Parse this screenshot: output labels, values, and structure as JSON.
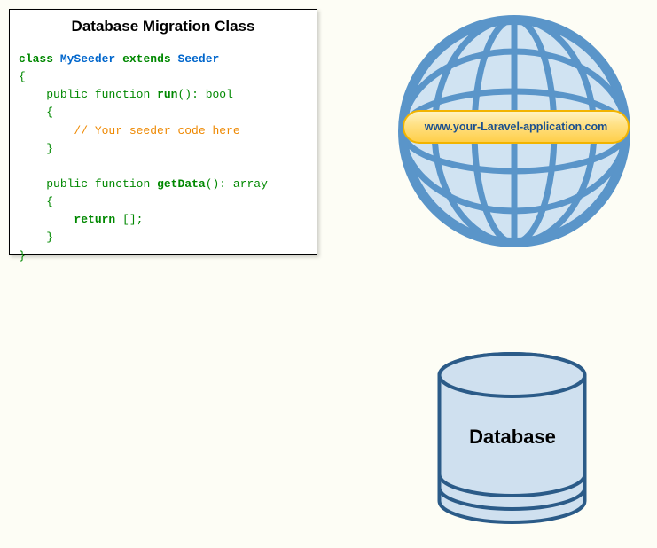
{
  "code_panel": {
    "title": "Database Migration Class",
    "lines": {
      "l1_kw_class": "class",
      "l1_name": "MySeeder",
      "l1_kw_extends": "extends",
      "l1_parent": "Seeder",
      "l2_brace": "{",
      "l3_pub": "public",
      "l3_func": "function",
      "l3_name": "run",
      "l3_paren": "():",
      "l3_ret": "bool",
      "l4_brace": "{",
      "l5_cmt": "// Your seeder code here",
      "l6_brace": "}",
      "l7_pub": "public",
      "l7_func": "function",
      "l7_name": "getData",
      "l7_paren": "():",
      "l7_ret": "array",
      "l8_brace": "{",
      "l9_kw": "return",
      "l9_val": "[];",
      "l10_brace": "}",
      "l11_brace": "}"
    }
  },
  "globe": {
    "url": "www.your-Laravel-application.com"
  },
  "database": {
    "label": "Database"
  }
}
